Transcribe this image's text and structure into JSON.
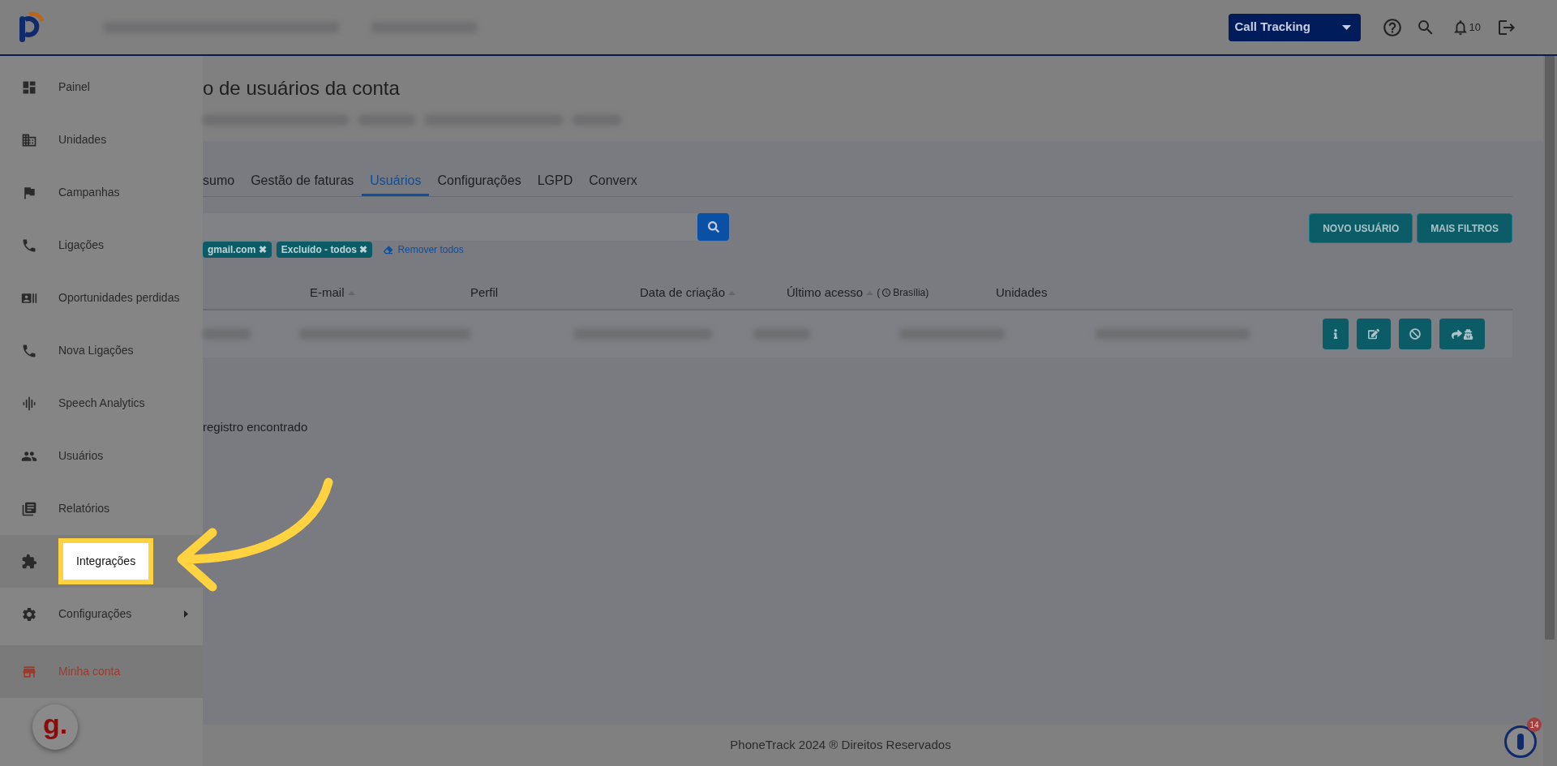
{
  "topbar": {
    "product_selector": "Call Tracking",
    "notifications": "10"
  },
  "sidebar": {
    "items": [
      {
        "label": "Painel",
        "kind": "item",
        "selected": false,
        "highlighted": false,
        "submenu": false
      },
      {
        "label": "Unidades",
        "kind": "item",
        "selected": false,
        "highlighted": false,
        "submenu": false
      },
      {
        "label": "Campanhas",
        "kind": "item",
        "selected": false,
        "highlighted": false,
        "submenu": false
      },
      {
        "label": "Ligações",
        "kind": "item",
        "selected": false,
        "highlighted": false,
        "submenu": false
      },
      {
        "label": "Oportunidades perdidas",
        "kind": "item",
        "selected": false,
        "highlighted": false,
        "submenu": false
      },
      {
        "label": "Nova Ligações",
        "kind": "item",
        "selected": false,
        "highlighted": false,
        "submenu": false
      },
      {
        "label": "Speech Analytics",
        "kind": "item",
        "selected": false,
        "highlighted": false,
        "submenu": false
      },
      {
        "label": "Usuários",
        "kind": "item",
        "selected": false,
        "highlighted": false,
        "submenu": false
      },
      {
        "label": "Relatórios",
        "kind": "item",
        "selected": false,
        "highlighted": false,
        "submenu": false
      },
      {
        "label": "Integrações",
        "kind": "item",
        "selected": false,
        "highlighted": true,
        "submenu": false
      },
      {
        "label": "Configurações",
        "kind": "item",
        "selected": false,
        "highlighted": false,
        "submenu": true
      },
      {
        "label": "Minha conta",
        "kind": "account",
        "selected": true,
        "highlighted": false,
        "submenu": false
      }
    ],
    "widget": "g."
  },
  "page": {
    "title": "o de usuários da conta"
  },
  "tabs": [
    {
      "label": "sumo",
      "selected": false
    },
    {
      "label": "Gestão de faturas",
      "selected": false
    },
    {
      "label": "Usuários",
      "selected": true
    },
    {
      "label": "Configurações",
      "selected": false
    },
    {
      "label": "LGPD",
      "selected": false
    },
    {
      "label": "Converx",
      "selected": false
    }
  ],
  "filters": {
    "chips": [
      "gmail.com",
      "Excluído - todos"
    ],
    "chip_remove": "✖",
    "clear_link": "Remover todos"
  },
  "buttons": [
    "NOVO USUÁRIO",
    "MAIS FILTROS"
  ],
  "table": {
    "columns": [
      {
        "label": "E-mail",
        "sortable": true
      },
      {
        "label": "Perfil",
        "sortable": false
      },
      {
        "label": "Data de criação",
        "sortable": true
      },
      {
        "label": "Último acesso",
        "sortable": true,
        "note_open": "(",
        "note": "Brasília)"
      },
      {
        "label": "Unidades",
        "sortable": false
      }
    ]
  },
  "result_text": "registro encontrado",
  "footer": "PhoneTrack 2024 ® Direitos Reservados",
  "chat_widget": {
    "badge": "14"
  }
}
